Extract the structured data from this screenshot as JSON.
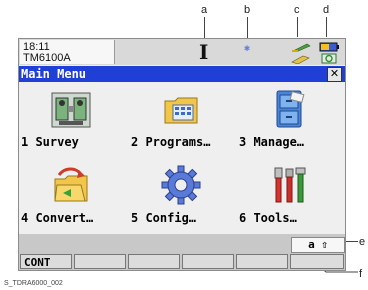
{
  "callouts": {
    "a": "a",
    "b": "b",
    "c": "c",
    "d": "d",
    "e": "e",
    "f": "f"
  },
  "status": {
    "time": "18:11",
    "instrument": "TM6100A",
    "cursor_glyph": "I",
    "bluetooth_glyph": "✱"
  },
  "titlebar": {
    "title": "Main Menu",
    "close": "✕"
  },
  "menu": {
    "items": [
      {
        "label": "1 Survey",
        "icon": "survey-instrument-icon"
      },
      {
        "label": "2 Programs…",
        "icon": "programs-folder-icon"
      },
      {
        "label": "3 Manage…",
        "icon": "manage-cabinet-icon"
      },
      {
        "label": "4 Convert…",
        "icon": "convert-folder-icon"
      },
      {
        "label": "5 Config…",
        "icon": "config-gear-icon"
      },
      {
        "label": "6 Tools…",
        "icon": "tools-icon"
      }
    ]
  },
  "input_mode": {
    "text": "a ⇧"
  },
  "function_keys": {
    "f1": "CONT",
    "f2": "",
    "f3": "",
    "f4": "",
    "f5": "",
    "f6": ""
  },
  "caption": "S_TDRA6000_002",
  "colors": {
    "title_bar": "#1f3fd6",
    "screen_bg": "#efefef"
  }
}
